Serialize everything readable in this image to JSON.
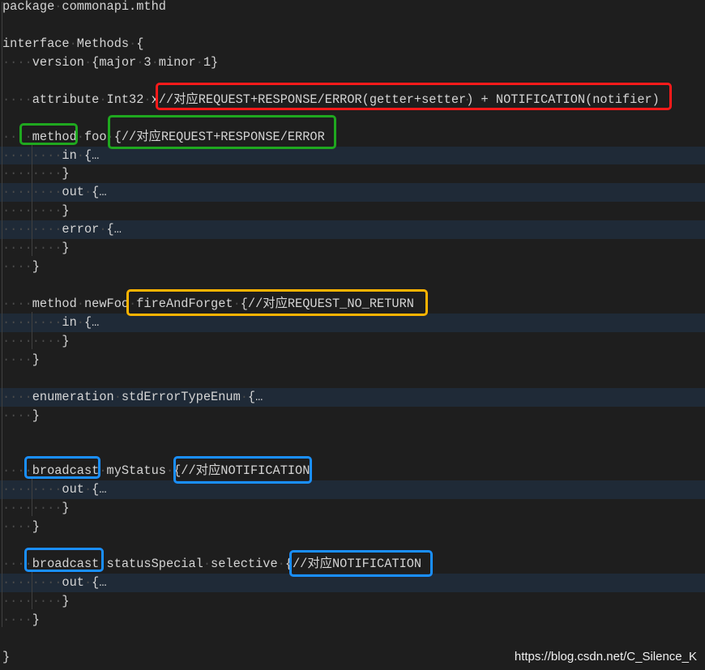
{
  "code_lines": [
    {
      "text": "package commonapi.mthd"
    },
    {
      "text": ""
    },
    {
      "text": "interface Methods {"
    },
    {
      "text": "    version {major 3 minor 1}"
    },
    {
      "text": ""
    },
    {
      "text": "    attribute Int32 x//对应REQUEST+RESPONSE/ERROR(getter+setter) + NOTIFICATION(notifier)"
    },
    {
      "text": ""
    },
    {
      "text": "    method foo {//对应REQUEST+RESPONSE/ERROR"
    },
    {
      "text": "        in {…",
      "folded": true
    },
    {
      "text": "        }"
    },
    {
      "text": "        out {…",
      "folded": true
    },
    {
      "text": "        }"
    },
    {
      "text": "        error {…",
      "folded": true
    },
    {
      "text": "        }"
    },
    {
      "text": "    }"
    },
    {
      "text": ""
    },
    {
      "text": "    method newFoo fireAndForget {//对应REQUEST_NO_RETURN"
    },
    {
      "text": "        in {…",
      "folded": true
    },
    {
      "text": "        }"
    },
    {
      "text": "    }"
    },
    {
      "text": ""
    },
    {
      "text": "    enumeration stdErrorTypeEnum {…",
      "folded": true
    },
    {
      "text": "    }"
    },
    {
      "text": ""
    },
    {
      "text": ""
    },
    {
      "text": "    broadcast myStatus {//对应NOTIFICATION"
    },
    {
      "text": "        out {…",
      "folded": true
    },
    {
      "text": "        }"
    },
    {
      "text": "    }"
    },
    {
      "text": ""
    },
    {
      "text": "    broadcast statusSpecial selective {//对应NOTIFICATION"
    },
    {
      "text": "        out {…",
      "folded": true
    },
    {
      "text": "        }"
    },
    {
      "text": "    }"
    },
    {
      "text": ""
    },
    {
      "text": "}"
    }
  ],
  "annotation_colors": {
    "red": "#ff1a1a",
    "green": "#1fa81f",
    "yellow": "#ffb400",
    "blue": "#1a8fff"
  },
  "watermark": "https://blog.csdn.net/C_Silence_K"
}
